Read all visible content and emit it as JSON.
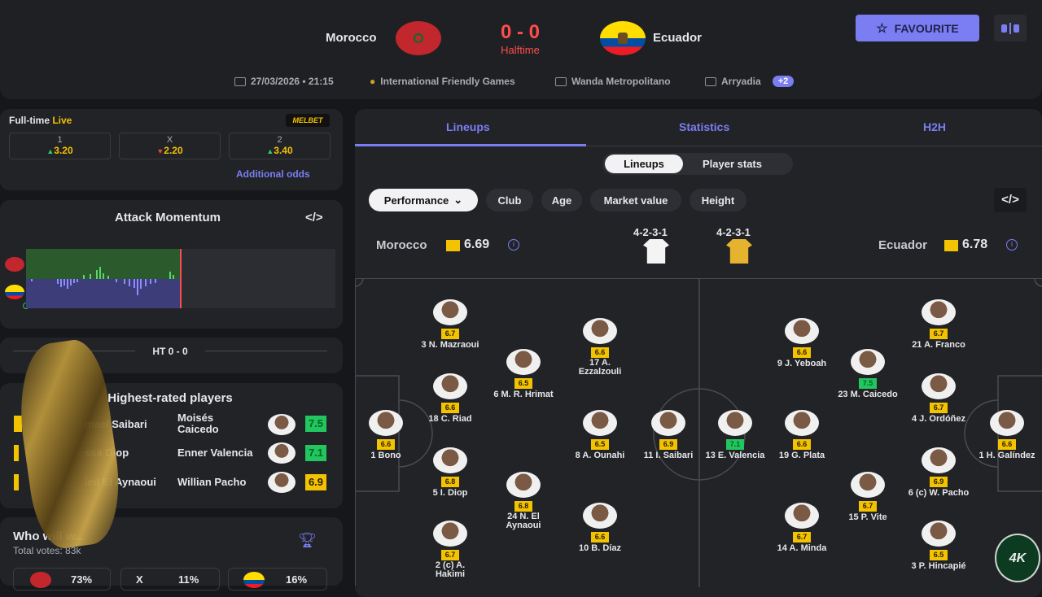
{
  "match": {
    "home": "Morocco",
    "away": "Ecuador",
    "score": "0 - 0",
    "status": "Halftime",
    "favourite_label": "FAVOURITE",
    "date": "27/03/2026 • 21:15",
    "competition": "International Friendly Games",
    "stadium": "Wanda Metropolitano",
    "referee": "Arryadia",
    "more_badge": "+2",
    "colors": {
      "accent": "#7b7ef3",
      "score": "#ff4d4d",
      "home_flag": "#c1272d",
      "away_flag": "#ffdd00"
    }
  },
  "odds": {
    "title": "Full-time",
    "live": "Live",
    "bookmaker": "MELBET",
    "items": [
      {
        "label": "1",
        "value": "3.20",
        "trend": "up"
      },
      {
        "label": "X",
        "value": "2.20",
        "trend": "down"
      },
      {
        "label": "2",
        "value": "3.40",
        "trend": "up"
      }
    ],
    "additional": "Additional odds"
  },
  "momentum": {
    "title": "Attack Momentum",
    "embed": "</>"
  },
  "ht_label": "HT 0 - 0",
  "highest": {
    "title": "Highest-rated players",
    "left": [
      {
        "name": "mael Saibari",
        "rating": "6"
      },
      {
        "name": "ssa Diop",
        "rating": ""
      },
      {
        "name": "leil El Aynaoui",
        "rating": ""
      }
    ],
    "right": [
      {
        "name": "Moisés Caicedo",
        "rating": "7.5"
      },
      {
        "name": "Enner Valencia",
        "rating": "7.1"
      },
      {
        "name": "Willian Pacho",
        "rating": "6.9"
      }
    ]
  },
  "who_wins": {
    "title": "Who will w...",
    "votes": "Total votes: 83k",
    "home_pct": "73%",
    "draw_label": "X",
    "draw_pct": "11%",
    "away_pct": "16%"
  },
  "tabs": [
    "Lineups",
    "Statistics",
    "H2H"
  ],
  "subtabs": [
    "Lineups",
    "Player stats"
  ],
  "filters": [
    "Performance",
    "Club",
    "Age",
    "Market value",
    "Height"
  ],
  "embed_label": "</>",
  "team_ratings": {
    "home_name": "Morocco",
    "home_rating": "6.69",
    "home_formation": "4-2-3-1",
    "away_name": "Ecuador",
    "away_rating": "6.78",
    "away_formation": "4-2-3-1"
  },
  "players": [
    {
      "name": "3 N. Mazraoui",
      "rating": "6.7"
    },
    {
      "name": "18 C. Riad",
      "rating": "6.6"
    },
    {
      "name": "5 I. Diop",
      "rating": "6.8"
    },
    {
      "name": "2 (c) A. Hakimi",
      "rating": "6.7"
    },
    {
      "name": "1 Bono",
      "rating": "6.6"
    },
    {
      "name": "6 M. R. Hrimat",
      "rating": "6.5"
    },
    {
      "name": "24 N. El Aynaoui",
      "rating": "6.8"
    },
    {
      "name": "17 A. Ezzalzouli",
      "rating": "6.6"
    },
    {
      "name": "8 A. Ounahi",
      "rating": "6.5"
    },
    {
      "name": "10 B. Díaz",
      "rating": "6.6"
    },
    {
      "name": "11 I. Saibari",
      "rating": "6.9"
    },
    {
      "name": "13 E. Valencia",
      "rating": "7.1"
    },
    {
      "name": "9 J. Yeboah",
      "rating": "6.6"
    },
    {
      "name": "19 G. Plata",
      "rating": "6.6"
    },
    {
      "name": "14 A. Minda",
      "rating": "6.7"
    },
    {
      "name": "23 M. Caicedo",
      "rating": "7.5"
    },
    {
      "name": "15 P. Vite",
      "rating": "6.7"
    },
    {
      "name": "21 A. Franco",
      "rating": "6.7"
    },
    {
      "name": "4 J. Ordóñez",
      "rating": "6.7"
    },
    {
      "name": "6 (c) W. Pacho",
      "rating": "6.9"
    },
    {
      "name": "3 P. Hincapié",
      "rating": "6.5"
    },
    {
      "name": "1 H. Galíndez",
      "rating": "6.6"
    }
  ],
  "watermark": "4K"
}
